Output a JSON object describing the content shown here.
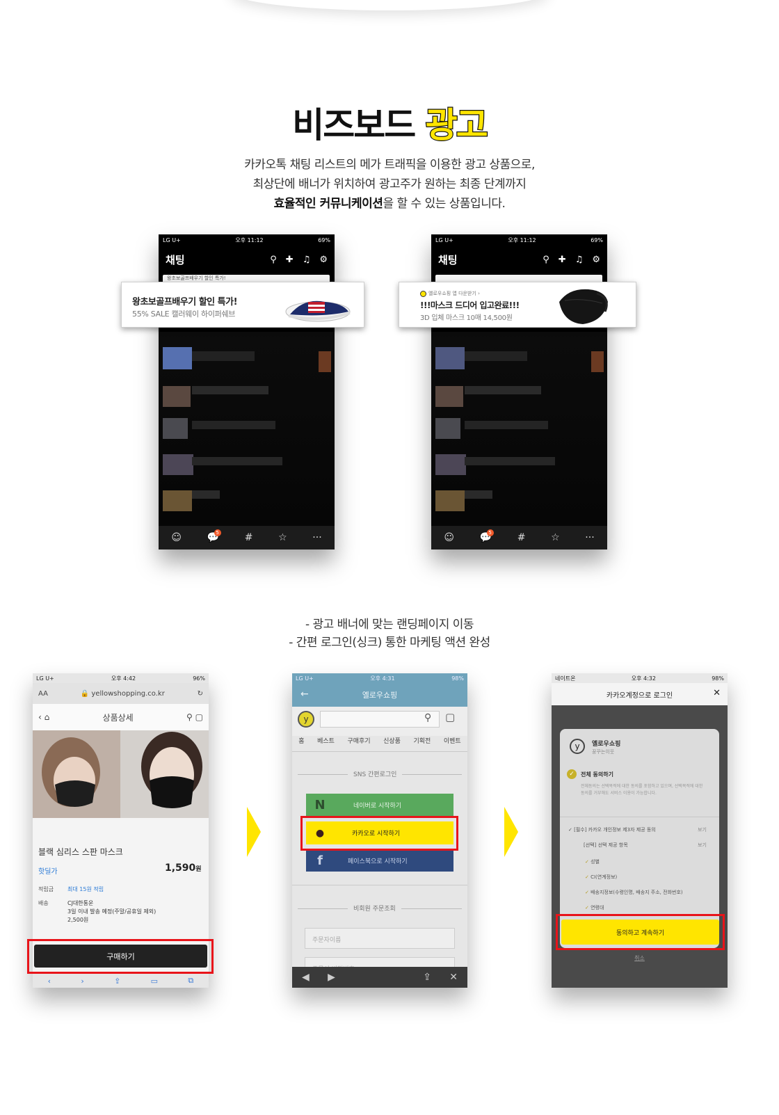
{
  "title": {
    "part1": "비즈보드",
    "part2": "광고"
  },
  "description": {
    "line1": "카카오톡 채팅 리스트의 메가 트래픽을 이용한 광고 상품으로,",
    "line2": "최상단에 배너가 위치하여 광고주가 원하는 최종 단계까지",
    "line3_bold": "효율적인 커뮤니케이션",
    "line3_rest": "을 할 수 있는 상품입니다."
  },
  "phone_status": {
    "carrier": "LG U+",
    "time": "오후 11:12",
    "battery": "69%"
  },
  "chat_header": {
    "title": "채팅"
  },
  "tab_badge": "5",
  "banner1": {
    "title": "왕초보골프배우기 할인 특가!",
    "subtitle": "55% SALE 캘러웨이 하이퍼쉐브",
    "behind_text": "왕초보골프배우기 할인 특가!"
  },
  "banner2": {
    "advertiser": "옐로우쇼핑 앱 다운받기 ›",
    "title": "!!!마스크 드디어 입고완료!!!",
    "subtitle": "3D 입체 마스크 10매 14,500원"
  },
  "subtitle": {
    "line1": "- 광고 배너에 맞는 랜딩페이지 이동",
    "line2": "- 간편 로그인(싱크) 통한 마케팅 액션 완성"
  },
  "shot1": {
    "status_carrier": "LG U+",
    "status_time": "오후 4:42",
    "status_battery": "96%",
    "aa": "AA",
    "url": "yellowshopping.co.kr",
    "page_title": "상품상세",
    "product_name": "블랙 심리스 스판 마스크",
    "hot_label": "핫딜가",
    "price": "1,590",
    "price_unit": "원",
    "point_label": "적립금",
    "point_value": "최대 15원 적립",
    "ship_label": "배송",
    "ship_line1": "CJ대한통운",
    "ship_line2": "3일 이내 발송 예정(주말/공휴일 제외)",
    "ship_line3": "2,500원",
    "buy_button": "구매하기"
  },
  "shot2": {
    "status_carrier": "LG U+",
    "status_time": "오후 4:31",
    "status_battery": "98%",
    "app_title": "옐로우쇼핑",
    "nav": [
      "홈",
      "베스트",
      "구매후기",
      "신상품",
      "기획전",
      "이벤트"
    ],
    "sns_label": "SNS 간편로그인",
    "naver": "네이버로 시작하기",
    "kakao": "카카오로 시작하기",
    "facebook": "페이스북으로 시작하기",
    "guest_label": "비회원 주문조회",
    "field1": "주문자이름",
    "field2": "주문서 비밀번호"
  },
  "shot3": {
    "status_carrier": "네이트온",
    "status_time": "오후 4:32",
    "status_battery": "98%",
    "header": "카카오계정으로 로그인",
    "app_name": "옐로우쇼핑",
    "app_sub": "꿍꾸는이웃",
    "agree_all": "전체 동의하기",
    "agree_desc": "전체동의는 선택목적에 대한 동의를 포함하고 있으며, 선택목적에 대한 동의를 거부해도 서비스 이용이 가능합니다.",
    "item1": "[필수] 카카오 개인정보 제3자 제공 동의",
    "item2": "[선택] 선택 제공 항목",
    "view": "보기",
    "sub1": "성별",
    "sub2": "CI(연계정보)",
    "sub3": "배송지정보(수령인명, 배송지 주소, 전화번호)",
    "sub4": "연령대",
    "continue": "동의하고 계속하기",
    "cancel": "취소"
  }
}
